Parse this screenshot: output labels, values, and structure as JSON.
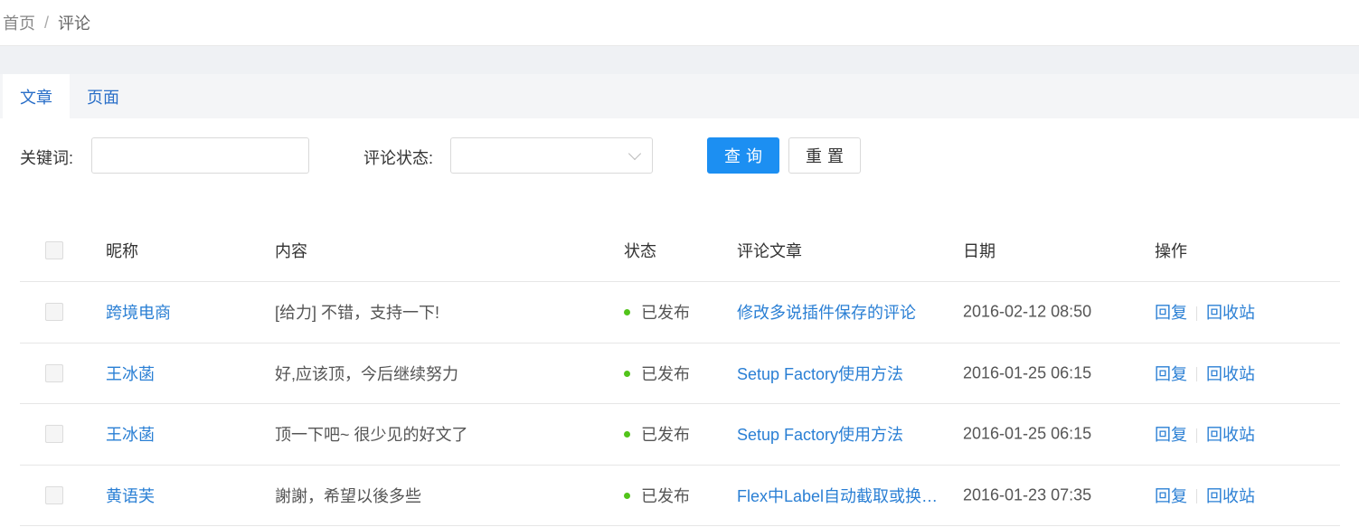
{
  "breadcrumb": {
    "home": "首页",
    "separator": "/",
    "current": "评论"
  },
  "tabs": [
    {
      "label": "文章",
      "active": true
    },
    {
      "label": "页面",
      "active": false
    }
  ],
  "filters": {
    "keyword_label": "关键词:",
    "keyword_value": "",
    "keyword_placeholder": "",
    "status_label": "评论状态:",
    "status_value": "",
    "query_button": "查询",
    "reset_button": "重置"
  },
  "table": {
    "columns": [
      "昵称",
      "内容",
      "状态",
      "评论文章",
      "日期",
      "操作"
    ],
    "rows": [
      {
        "nickname": "跨境电商",
        "content": "[给力] 不错，支持一下!",
        "status": "已发布",
        "article": "修改多说插件保存的评论",
        "date": "2016-02-12 08:50",
        "action_reply": "回复",
        "action_trash": "回收站"
      },
      {
        "nickname": "王冰菡",
        "content": "好,应该顶，今后继续努力",
        "status": "已发布",
        "article": "Setup Factory使用方法",
        "date": "2016-01-25 06:15",
        "action_reply": "回复",
        "action_trash": "回收站"
      },
      {
        "nickname": "王冰菡",
        "content": "顶一下吧~ 很少见的好文了",
        "status": "已发布",
        "article": "Setup Factory使用方法",
        "date": "2016-01-25 06:15",
        "action_reply": "回复",
        "action_trash": "回收站"
      },
      {
        "nickname": "黄语芙",
        "content": "謝謝，希望以後多些",
        "status": "已发布",
        "article": "Flex中Label自动截取或换…",
        "date": "2016-01-23 07:35",
        "action_reply": "回复",
        "action_trash": "回收站"
      }
    ]
  },
  "colors": {
    "accent": "#1c8ff2",
    "link": "#2a7fd4",
    "status_published": "#52c41a"
  }
}
